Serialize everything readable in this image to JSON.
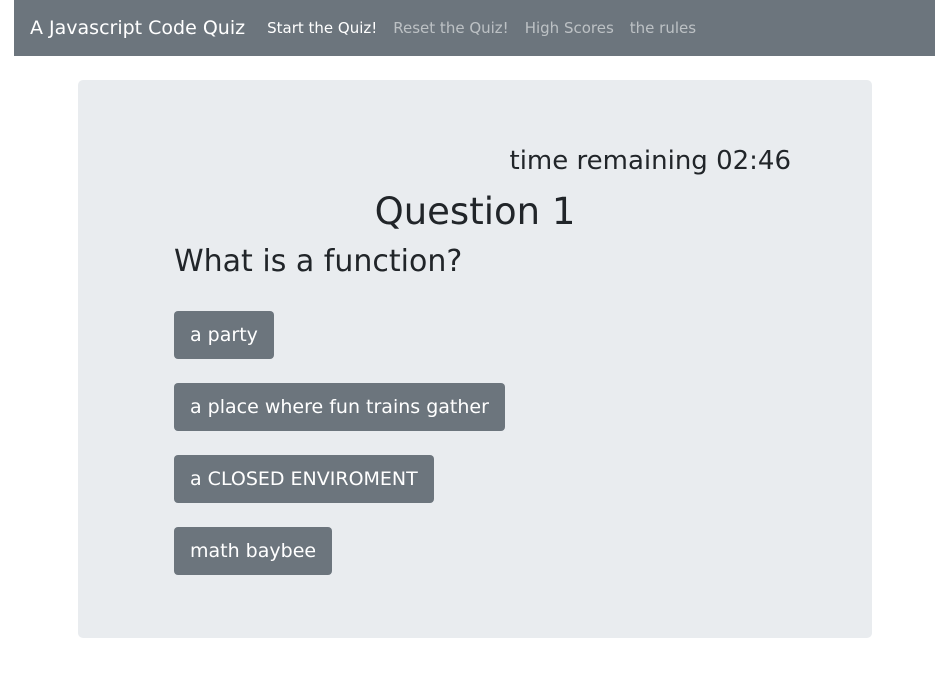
{
  "navbar": {
    "brand": "A Javascript Code Quiz",
    "links": [
      {
        "label": "Start the Quiz!"
      },
      {
        "label": "Reset the Quiz!"
      },
      {
        "label": "High Scores"
      },
      {
        "label": "the rules"
      }
    ]
  },
  "quiz": {
    "timer_text": "time remaining 02:46",
    "question_number": "Question 1",
    "question_text": "What is a function?",
    "answers": [
      {
        "label": "a party"
      },
      {
        "label": "a place where fun trains gather"
      },
      {
        "label": "a CLOSED ENVIROMENT"
      },
      {
        "label": "math baybee"
      }
    ]
  },
  "colors": {
    "navbar_bg": "#6c757d",
    "panel_bg": "#e9ecef",
    "button_bg": "#6c757d",
    "text": "#212529"
  }
}
